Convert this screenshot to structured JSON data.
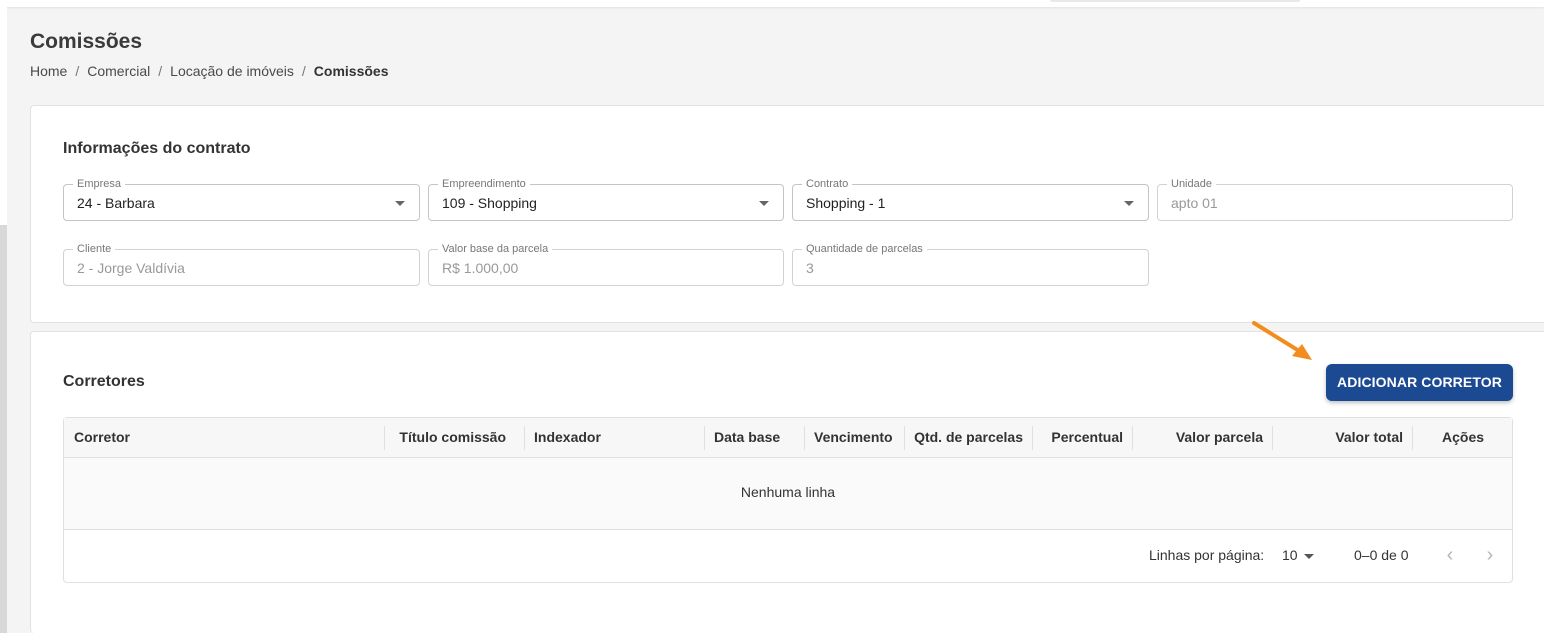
{
  "header": {
    "title": "Comissões",
    "breadcrumb": [
      "Home",
      "Comercial",
      "Locação de imóveis",
      "Comissões"
    ]
  },
  "contract_info": {
    "title": "Informações do contrato",
    "fields": {
      "empresa": {
        "label": "Empresa",
        "value": "24 - Barbara"
      },
      "empreendimento": {
        "label": "Empreendimento",
        "value": "109 - Shopping"
      },
      "contrato": {
        "label": "Contrato",
        "value": "Shopping - 1"
      },
      "unidade": {
        "label": "Unidade",
        "value": "apto 01"
      },
      "cliente": {
        "label": "Cliente",
        "value": "2 - Jorge Valdívia"
      },
      "valor_base": {
        "label": "Valor base da parcela",
        "value": "R$ 1.000,00"
      },
      "qtd_parcelas": {
        "label": "Quantidade de parcelas",
        "value": "3"
      }
    }
  },
  "brokers": {
    "title": "Corretores",
    "add_button": "ADICIONAR CORRETOR",
    "columns": [
      "Corretor",
      "Título comissão",
      "Indexador",
      "Data base",
      "Vencimento",
      "Qtd. de parcelas",
      "Percentual",
      "Valor parcela",
      "Valor total",
      "Ações"
    ],
    "empty_text": "Nenhuma linha",
    "footer": {
      "rows_per_page_label": "Linhas por página:",
      "rows_per_page_value": "10",
      "range": "0–0 de 0"
    }
  },
  "colors": {
    "primary_button": "#1b4a93",
    "annotation_arrow": "#f28c1e"
  },
  "icons": [
    "chevron-left-icon",
    "chevron-right-icon",
    "dropdown-caret-icon",
    "annotation-arrow-icon"
  ]
}
